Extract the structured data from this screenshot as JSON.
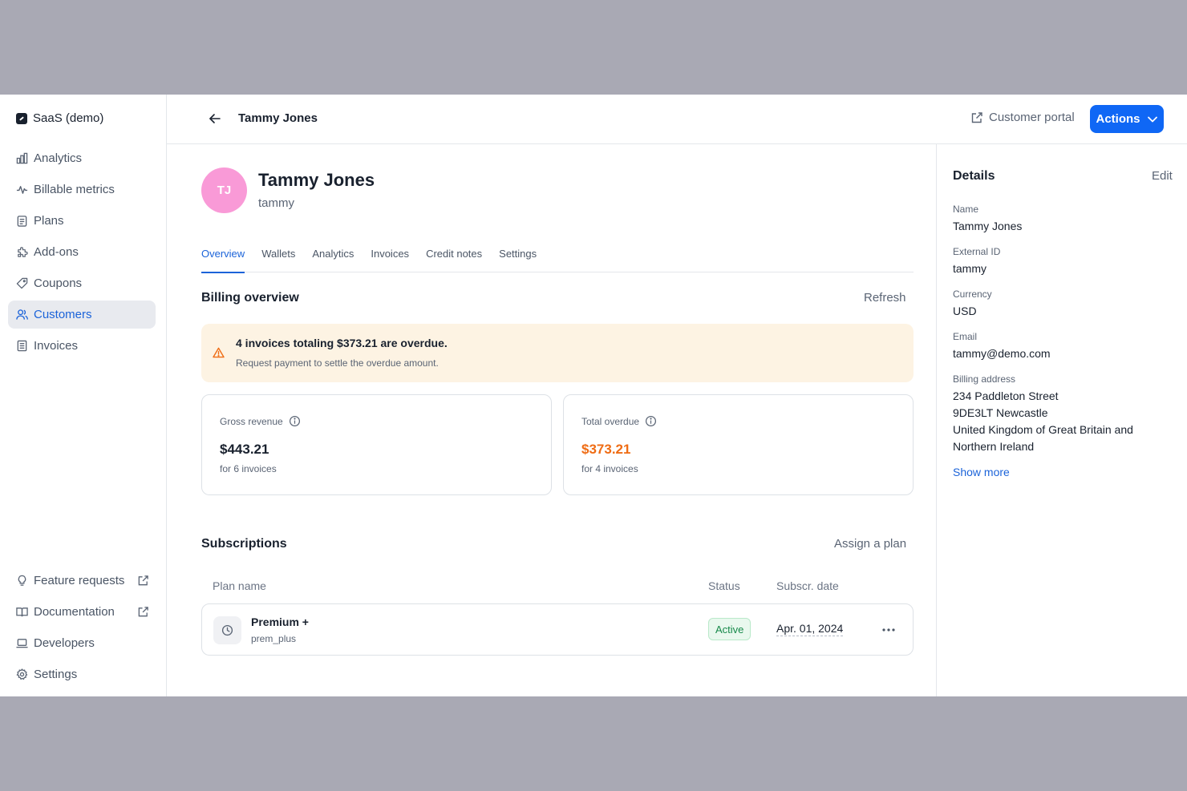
{
  "org": {
    "name": "SaaS (demo)"
  },
  "sidebar": {
    "items": [
      {
        "label": "Analytics",
        "icon": "bar-chart-icon"
      },
      {
        "label": "Billable metrics",
        "icon": "pulse-icon"
      },
      {
        "label": "Plans",
        "icon": "clipboard-icon"
      },
      {
        "label": "Add-ons",
        "icon": "puzzle-icon"
      },
      {
        "label": "Coupons",
        "icon": "tag-icon"
      },
      {
        "label": "Customers",
        "icon": "users-icon",
        "active": true
      },
      {
        "label": "Invoices",
        "icon": "document-icon"
      }
    ],
    "bottom_items": [
      {
        "label": "Feature requests",
        "icon": "lightbulb-icon",
        "external": true
      },
      {
        "label": "Documentation",
        "icon": "book-icon",
        "external": true
      },
      {
        "label": "Developers",
        "icon": "laptop-icon"
      },
      {
        "label": "Settings",
        "icon": "gear-icon"
      }
    ]
  },
  "header": {
    "title": "Tammy Jones",
    "portal_label": "Customer portal",
    "actions_label": "Actions"
  },
  "customer": {
    "initials": "TJ",
    "name": "Tammy Jones",
    "external_id": "tammy",
    "avatar_color": "#f99ad7"
  },
  "tabs": [
    "Overview",
    "Wallets",
    "Analytics",
    "Invoices",
    "Credit notes",
    "Settings"
  ],
  "billing": {
    "title": "Billing overview",
    "refresh_label": "Refresh",
    "alert_title": "4 invoices totaling $373.21 are overdue.",
    "alert_subtitle": "Request payment to settle the overdue amount.",
    "gross_label": "Gross revenue",
    "gross_value": "$443.21",
    "gross_sub": "for 6 invoices",
    "overdue_label": "Total overdue",
    "overdue_value": "$373.21",
    "overdue_sub": "for 4 invoices"
  },
  "subscriptions": {
    "title": "Subscriptions",
    "assign_label": "Assign a plan",
    "columns": [
      "Plan name",
      "Status",
      "Subscr. date"
    ],
    "rows": [
      {
        "plan": "Premium +",
        "code": "prem_plus",
        "status": "Active",
        "date": "Apr. 01, 2024"
      }
    ]
  },
  "details": {
    "title": "Details",
    "edit_label": "Edit",
    "fields": [
      {
        "label": "Name",
        "value": "Tammy Jones"
      },
      {
        "label": "External ID",
        "value": "tammy"
      },
      {
        "label": "Currency",
        "value": "USD"
      },
      {
        "label": "Email",
        "value": "tammy@demo.com"
      }
    ],
    "billing_label": "Billing address",
    "billing_lines": [
      "234 Paddleton Street",
      "9DE3LT Newcastle",
      "United Kingdom of Great Britain and",
      "Northern Ireland"
    ],
    "show_more_label": "Show more"
  },
  "colors": {
    "accent": "#0f67f5",
    "overdue": "#ef6c14",
    "active_status": "#17894a",
    "alert_bg": "#fdf3e3"
  }
}
